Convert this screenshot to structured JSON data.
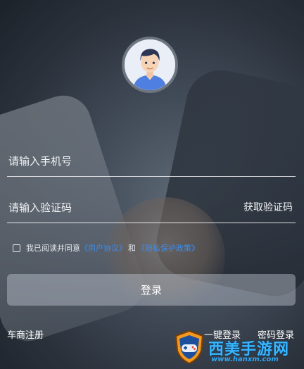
{
  "form": {
    "phone_placeholder": "请输入手机号",
    "code_placeholder": "请输入验证码",
    "get_code": "获取验证码"
  },
  "agreement": {
    "prefix": "我已阅读并同意",
    "user_agreement": "《用户协议》",
    "connector": "和",
    "privacy_policy": "《隐私保护政策》"
  },
  "login_button": "登录",
  "bottom": {
    "dealer_register": "车商注册",
    "one_click_login": "一键登录",
    "password_login": "密码登录"
  },
  "watermark": {
    "name": "西美手游网",
    "url": "www.hanxm.com"
  },
  "colors": {
    "link": "#3b8df0",
    "watermark": "#37b6ff"
  },
  "icons": {
    "avatar": "default-user-avatar-icon",
    "checkbox": "checkbox-unchecked-icon",
    "watermark_logo": "gamepad-shield-icon"
  }
}
